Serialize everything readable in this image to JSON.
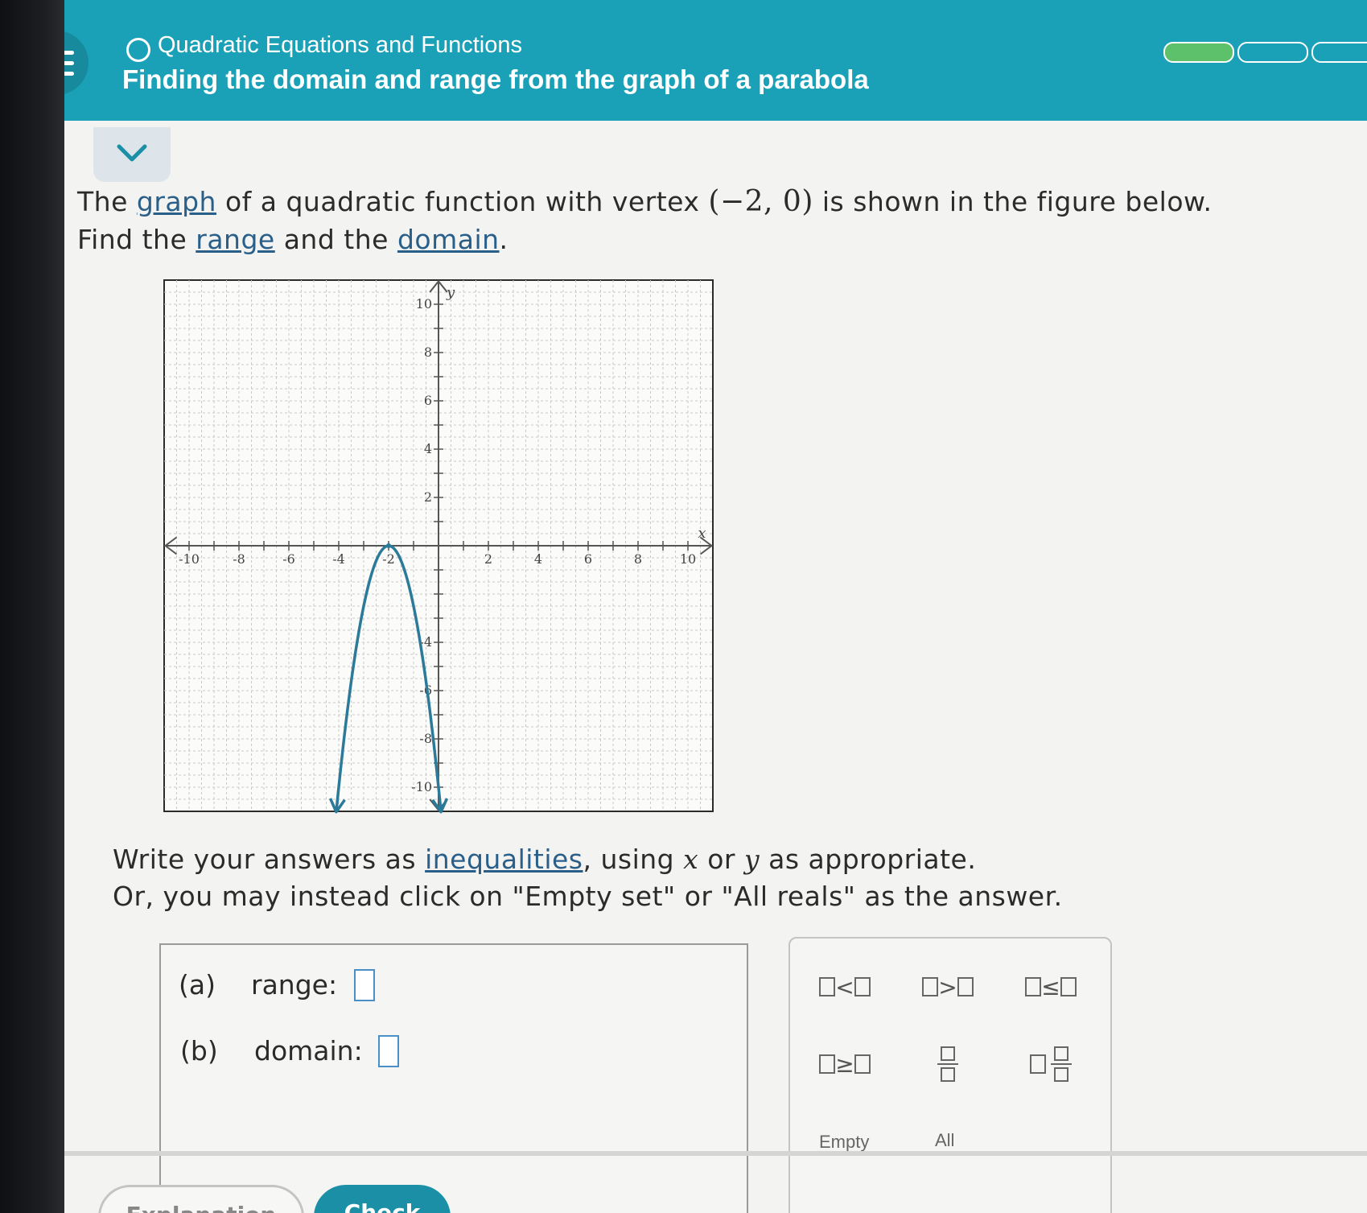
{
  "header": {
    "topic": "Quadratic Equations and Functions",
    "lesson": "Finding the domain and range from the graph of a parabola",
    "progress_filled_segments": 1,
    "progress_total_segments": 3
  },
  "question": {
    "p1_a": "The ",
    "p1_link_graph": "graph",
    "p1_b": " of a quadratic function with vertex ",
    "vertex": "(−2, 0)",
    "p1_c": " is shown in the figure below.",
    "p2_a": "Find the ",
    "p2_link_range": "range",
    "p2_b": " and the ",
    "p2_link_domain": "domain",
    "p2_c": ".",
    "i1_a": "Write your answers as ",
    "i1_link": "inequalities",
    "i1_b": ", using ",
    "i1_x": "x",
    "i1_c": " or ",
    "i1_y": "y",
    "i1_d": " as appropriate.",
    "i2": "Or, you may instead click on \"Empty set\" or \"All reals\" as the answer."
  },
  "chart_data": {
    "type": "line",
    "xlabel": "x",
    "ylabel": "y",
    "xlim": [
      -11,
      11
    ],
    "ylim": [
      -11,
      11
    ],
    "x_ticks": [
      "-10",
      "-8",
      "-6",
      "-4",
      "-2",
      "2",
      "4",
      "6",
      "8",
      "10"
    ],
    "y_ticks": [
      "10",
      "8",
      "6",
      "4",
      "2",
      "-4",
      "-6",
      "-8",
      "-10"
    ],
    "grid": true,
    "series": [
      {
        "function": "y = -2.5(x + 2)^2",
        "vertex": [
          -2,
          0
        ],
        "x_range": [
          -4.1,
          0.1
        ],
        "arrows": "both ends downward",
        "color": "#2b7a99"
      }
    ]
  },
  "answers": {
    "a_label": "(a)",
    "a_name": "range:",
    "b_label": "(b)",
    "b_name": "domain:"
  },
  "keypad": {
    "lt": "<",
    "gt": ">",
    "le": "≤",
    "ge": "≥",
    "empty": "Empty",
    "all": "All"
  },
  "buttons": {
    "explanation": "Explanation",
    "check": "Check"
  },
  "colors": {
    "header": "#1aa1b8",
    "progress": "#5cc16a",
    "link": "#2a5f8a",
    "curve": "#2b7a99",
    "check_button": "#1a8fa6"
  }
}
